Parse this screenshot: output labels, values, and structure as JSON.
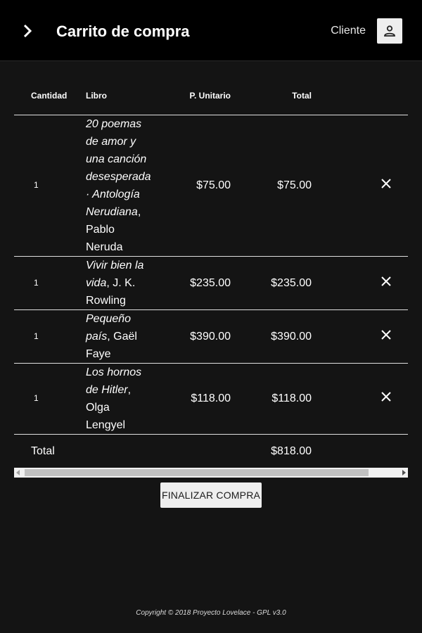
{
  "header": {
    "title": "Carrito de compra",
    "user_label": "Cliente",
    "menu_icon": "chevron-right-icon",
    "avatar_icon": "person-icon"
  },
  "cart": {
    "columns": {
      "quantity": "Cantidad",
      "book": "Libro",
      "unit_price": "P. Unitario",
      "total": "Total"
    },
    "rows": [
      {
        "quantity": "1",
        "title": "20 poemas de amor y una canción desesperada · Antología Nerudiana",
        "author": ", Pablo Neruda",
        "unit_price": "$75.00",
        "total": "$75.00"
      },
      {
        "quantity": "1",
        "title": "Vivir bien la vida",
        "author": ", J. K. Rowling",
        "unit_price": "$235.00",
        "total": "$235.00"
      },
      {
        "quantity": "1",
        "title": "Pequeño país",
        "author": ", Gaël Faye",
        "unit_price": "$390.00",
        "total": "$390.00"
      },
      {
        "quantity": "1",
        "title": "Los hornos de Hitler",
        "author": ", Olga Lengyel",
        "unit_price": "$118.00",
        "total": "$118.00"
      }
    ],
    "total_label": "Total",
    "total_value": "$818.00",
    "remove_icon": "close-icon"
  },
  "checkout": {
    "label": "Finalizar compra"
  },
  "footer": {
    "copyright": "Copyright © 2018 Proyecto Lovelace - GPL v3.0"
  },
  "colors": {
    "header_bg": "#000000",
    "page_bg": "#141414",
    "button_bg": "#eeeeee",
    "divider": "#e0e0e0"
  }
}
